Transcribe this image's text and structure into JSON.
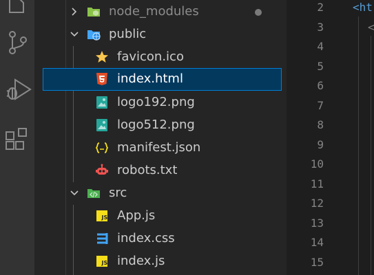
{
  "explorer": {
    "items": [
      {
        "label": "node_modules",
        "kind": "folder",
        "state": "collapsed",
        "icon": "node-folder-icon"
      },
      {
        "label": "public",
        "kind": "folder",
        "state": "expanded",
        "icon": "public-folder-icon"
      },
      {
        "label": "favicon.ico",
        "kind": "file",
        "icon": "star-icon"
      },
      {
        "label": "index.html",
        "kind": "file",
        "icon": "html5-icon",
        "selected": true
      },
      {
        "label": "logo192.png",
        "kind": "file",
        "icon": "image-icon"
      },
      {
        "label": "logo512.png",
        "kind": "file",
        "icon": "image-icon"
      },
      {
        "label": "manifest.json",
        "kind": "file",
        "icon": "json-icon"
      },
      {
        "label": "robots.txt",
        "kind": "file",
        "icon": "robot-icon"
      },
      {
        "label": "src",
        "kind": "folder",
        "state": "expanded",
        "icon": "src-folder-icon"
      },
      {
        "label": "App.js",
        "kind": "file",
        "icon": "js-icon"
      },
      {
        "label": "index.css",
        "kind": "file",
        "icon": "css3-icon"
      },
      {
        "label": "index.js",
        "kind": "file",
        "icon": "js-icon"
      }
    ]
  },
  "editor": {
    "line_numbers": [
      "2",
      "3",
      "4",
      "5",
      "6",
      "7",
      "8",
      "9",
      "10",
      "11",
      "12",
      "13",
      "14",
      "15"
    ],
    "code_fragments": {
      "line2": "<ht",
      "line3": "<"
    }
  },
  "colors": {
    "selection_bg": "#04395e",
    "selection_border": "#007fd4",
    "sidebar_bg": "#252526",
    "activity_bg": "#333333",
    "editor_bg": "#1e1e1e",
    "html_icon": "#e44d26",
    "css_icon": "#42a5f5",
    "js_icon": "#f5de19",
    "image_icon": "#26a69a",
    "json_icon": "#f5de19",
    "robot_icon": "#ef5350",
    "star_icon": "#f9c74f"
  }
}
